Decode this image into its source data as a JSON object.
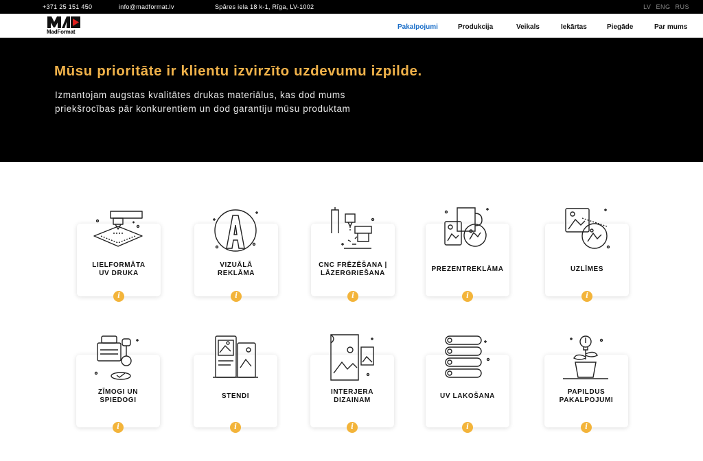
{
  "topbar": {
    "phone": "+371 25 151 450",
    "email": "info@madformat.lv",
    "address": "Spāres iela 18 k-1, Rīga, LV-1002",
    "languages": [
      "LV",
      "ENG",
      "RUS"
    ]
  },
  "brand": {
    "name": "MadFormat"
  },
  "nav": {
    "items": [
      {
        "label": "Pakalpojumi",
        "active": true
      },
      {
        "label": "Produkcija",
        "active": false
      },
      {
        "label": "Veikals",
        "active": false
      },
      {
        "label": "Iekārtas",
        "active": false
      },
      {
        "label": "Piegāde",
        "active": false
      },
      {
        "label": "Par mums",
        "active": false
      }
    ]
  },
  "hero": {
    "title": "Mūsu prioritāte ir klientu izvirzīto uzdevumu izpilde.",
    "text": "Izmantojam augstas kvalitātes drukas materiālus, kas dod mums priekšrocības pār konkurentiem un dod garantiju mūsu produktam"
  },
  "services": [
    {
      "line1": "LIELFORMĀTA",
      "line2": "UV DRUKA",
      "icon": "uv-printer-icon"
    },
    {
      "line1": "VIZUĀLĀ",
      "line2": "REKLĀMA",
      "icon": "visual-letter-icon"
    },
    {
      "line1": "CNC FRĒZĒŠANA |",
      "line2": "LĀZERGRIEŠANA",
      "icon": "cnc-laser-icon"
    },
    {
      "line1": "PREZENTREKLĀMA",
      "line2": "",
      "icon": "promo-items-icon"
    },
    {
      "line1": "UZLĪMES",
      "line2": "",
      "icon": "stickers-icon"
    },
    {
      "line1": "ZĪMOGI UN",
      "line2": "SPIEDOGI",
      "icon": "stamp-icon"
    },
    {
      "line1": "STENDI",
      "line2": "",
      "icon": "stands-icon"
    },
    {
      "line1": "INTERJERA",
      "line2": "DIZAINAM",
      "icon": "interior-print-icon"
    },
    {
      "line1": "UV LAKOŠANA",
      "line2": "",
      "icon": "uv-varnish-icon"
    },
    {
      "line1": "PAPILDUS",
      "line2": "PAKALPOJUMI",
      "icon": "extra-services-icon"
    }
  ],
  "info_glyph": "i",
  "colors": {
    "accent": "#f0b24a",
    "nav_active": "#1a6ec8",
    "info_badge": "#f3b43a"
  }
}
